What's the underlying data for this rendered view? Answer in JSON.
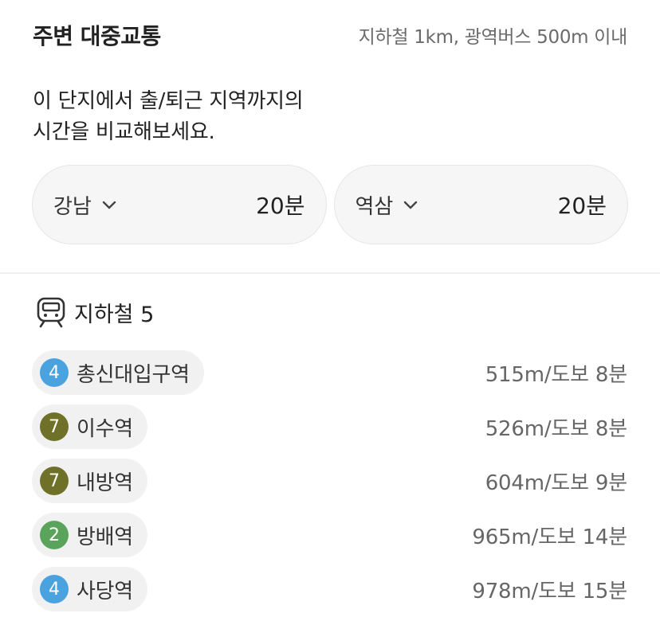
{
  "header": {
    "title": "주변 대중교통",
    "range_note": "지하철 1km, 광역버스 500m 이내"
  },
  "description": {
    "line1": "이 단지에서 출/퇴근 지역까지의",
    "line2": "시간을 비교해보세요."
  },
  "commute": [
    {
      "destination": "강남",
      "time": "20분",
      "icon": "chevron-down-icon"
    },
    {
      "destination": "역삼",
      "time": "20분",
      "icon": "chevron-down-icon"
    }
  ],
  "subway": {
    "icon": "train-icon",
    "label": "지하철 5",
    "stations": [
      {
        "line": "4",
        "line_color": "#4aa3df",
        "name": "총신대입구역",
        "distance": "515m/도보 8분"
      },
      {
        "line": "7",
        "line_color": "#6e7127",
        "name": "이수역",
        "distance": "526m/도보 8분"
      },
      {
        "line": "7",
        "line_color": "#6e7127",
        "name": "내방역",
        "distance": "604m/도보 9분"
      },
      {
        "line": "2",
        "line_color": "#5aa35a",
        "name": "방배역",
        "distance": "965m/도보 14분"
      },
      {
        "line": "4",
        "line_color": "#4aa3df",
        "name": "사당역",
        "distance": "978m/도보 15분"
      }
    ]
  }
}
